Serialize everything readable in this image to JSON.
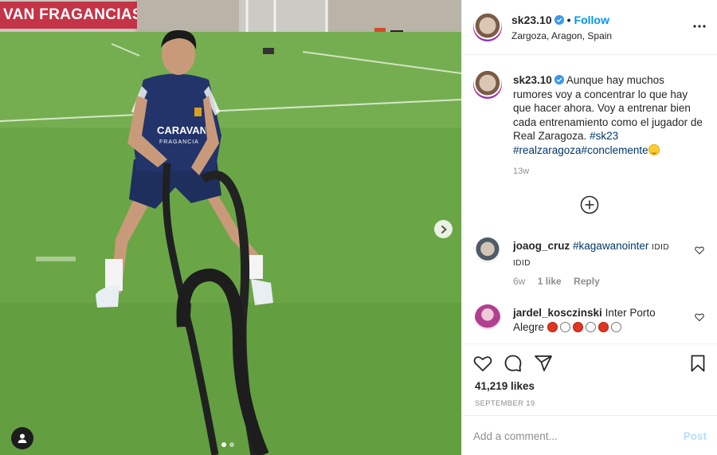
{
  "photo": {
    "banner_text": "VAN FRAGANCIAS",
    "shirt_text_1": "CARAVAN",
    "shirt_text_2": "FRAGANCIA",
    "next_icon": "chevron-right-icon",
    "tag_icon": "user-tag-icon",
    "slides_total": 2,
    "slide_active": 1
  },
  "header": {
    "username": "sk23.10",
    "verified_icon": "verified-badge-icon",
    "separator": "•",
    "follow_label": "Follow",
    "location": "Zargoza, Aragon, Spain",
    "more_icon": "more-options-icon"
  },
  "caption": {
    "username": "sk23.10",
    "text": "Aunque hay muchos rumores voy a concentrar lo que hay que hacer ahora. Voy a entrenar bien cada entrenamiento como el jugador de Real Zaragoza.",
    "hashtags": "#sk23 #realzaragoza#conclemente",
    "emoji_icon": "smiling-face-icon",
    "time": "13w",
    "load_more_icon": "load-more-comments-icon"
  },
  "comments": [
    {
      "username": "joaog_cruz",
      "tag": "#kagawanointer",
      "text": "IDID IDID",
      "time": "6w",
      "likes": "1 like",
      "reply_label": "Reply"
    },
    {
      "username": "jardel_kosczinski",
      "text": "Inter Porto Alegre",
      "circles": [
        "red",
        "white",
        "red",
        "white",
        "red",
        "white"
      ]
    }
  ],
  "actions": {
    "like_icon": "heart-icon",
    "comment_icon": "comment-icon",
    "share_icon": "share-icon",
    "save_icon": "bookmark-icon",
    "likes": "41,219 likes",
    "date": "SEPTEMBER 19"
  },
  "add_comment": {
    "placeholder": "Add a comment...",
    "post_label": "Post"
  },
  "colors": {
    "link_blue": "#0095f6",
    "hashtag_blue": "#00376b",
    "post_disabled": "#b2dffc",
    "banner_red": "#c43447"
  }
}
